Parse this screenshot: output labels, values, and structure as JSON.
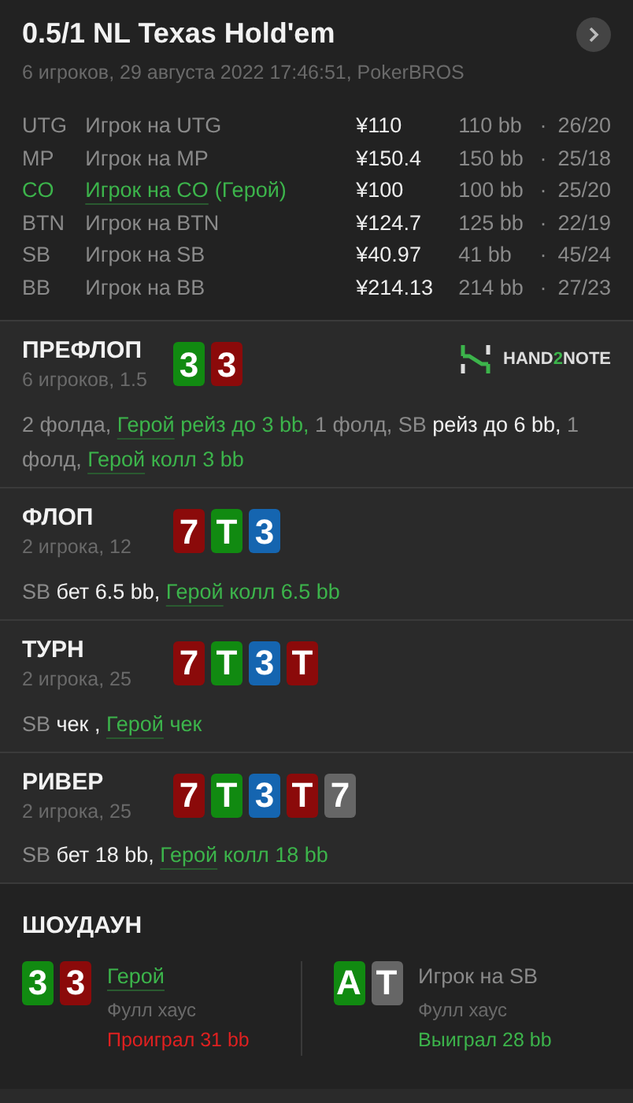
{
  "header": {
    "title": "0.5/1 NL Texas Hold'em",
    "subtitle": "6 игроков, 29 августа 2022 17:46:51, PokerBROS"
  },
  "players": [
    {
      "position": "UTG",
      "name": "Игрок на UTG",
      "hero": false,
      "stack": "¥110",
      "bb": "110 bb",
      "separator": "·",
      "stats": "26/20"
    },
    {
      "position": "MP",
      "name": "Игрок на MP",
      "hero": false,
      "stack": "¥150.4",
      "bb": "150 bb",
      "separator": "·",
      "stats": "25/18"
    },
    {
      "position": "CO",
      "name": "Игрок на CO",
      "hero_tag": "(Герой)",
      "hero": true,
      "stack": "¥100",
      "bb": "100 bb",
      "separator": "·",
      "stats": "25/20"
    },
    {
      "position": "BTN",
      "name": "Игрок на BTN",
      "hero": false,
      "stack": "¥124.7",
      "bb": "125 bb",
      "separator": "·",
      "stats": "22/19"
    },
    {
      "position": "SB",
      "name": "Игрок на SB",
      "hero": false,
      "stack": "¥40.97",
      "bb": "41 bb",
      "separator": "·",
      "stats": "45/24"
    },
    {
      "position": "BB",
      "name": "Игрок на BB",
      "hero": false,
      "stack": "¥214.13",
      "bb": "214 bb",
      "separator": "·",
      "stats": "27/23"
    }
  ],
  "logo": {
    "parts": [
      "HAND",
      "2",
      "NOTE"
    ]
  },
  "streets": [
    {
      "title": "ПРЕФЛОП",
      "info": "6 игроков, 1.5",
      "logo": true,
      "cards": [
        {
          "rank": "3",
          "color": "#118a11"
        },
        {
          "rank": "3",
          "color": "#8b0a0a"
        }
      ],
      "actions": [
        {
          "text": "2 фолда, ",
          "kind": "muted"
        },
        {
          "text": "Герой",
          "kind": "hero"
        },
        {
          "text": " рейз до 3 bb,",
          "kind": "hero_action"
        },
        {
          "text": " 1 фолд, SB ",
          "kind": "muted"
        },
        {
          "text": "рейз до 6 bb,",
          "kind": "action"
        },
        {
          "text": " 1 фолд, ",
          "kind": "muted"
        },
        {
          "text": "Герой",
          "kind": "hero"
        },
        {
          "text": " колл 3 bb",
          "kind": "hero_action"
        }
      ]
    },
    {
      "title": "ФЛОП",
      "info": "2 игрока, 12",
      "logo": false,
      "cards": [
        {
          "rank": "7",
          "color": "#8b0a0a"
        },
        {
          "rank": "T",
          "color": "#118a11"
        },
        {
          "rank": "3",
          "color": "#1565b0"
        }
      ],
      "actions": [
        {
          "text": "SB ",
          "kind": "muted"
        },
        {
          "text": "бет 6.5 bb, ",
          "kind": "action"
        },
        {
          "text": "Герой",
          "kind": "hero"
        },
        {
          "text": " колл 6.5 bb",
          "kind": "hero_action"
        }
      ]
    },
    {
      "title": "ТУРН",
      "info": "2 игрока, 25",
      "logo": false,
      "cards": [
        {
          "rank": "7",
          "color": "#8b0a0a"
        },
        {
          "rank": "T",
          "color": "#118a11"
        },
        {
          "rank": "3",
          "color": "#1565b0"
        },
        {
          "rank": "T",
          "color": "#8b0a0a"
        }
      ],
      "actions": [
        {
          "text": "SB ",
          "kind": "muted"
        },
        {
          "text": "чек , ",
          "kind": "action"
        },
        {
          "text": "Герой",
          "kind": "hero"
        },
        {
          "text": " чек",
          "kind": "hero_action"
        }
      ]
    },
    {
      "title": "РИВЕР",
      "info": "2 игрока, 25",
      "logo": false,
      "cards": [
        {
          "rank": "7",
          "color": "#8b0a0a"
        },
        {
          "rank": "T",
          "color": "#118a11"
        },
        {
          "rank": "3",
          "color": "#1565b0"
        },
        {
          "rank": "T",
          "color": "#8b0a0a"
        },
        {
          "rank": "7",
          "color": "#666666"
        }
      ],
      "actions": [
        {
          "text": "SB ",
          "kind": "muted"
        },
        {
          "text": "бет 18 bb, ",
          "kind": "action"
        },
        {
          "text": "Герой",
          "kind": "hero"
        },
        {
          "text": " колл 18 bb",
          "kind": "hero_action"
        }
      ]
    }
  ],
  "showdown": {
    "title": "ШОУДАУН",
    "hands": [
      {
        "name": "Герой",
        "hero": true,
        "hand": "Фулл хаус",
        "result": "Проиграл 31 bb",
        "won": false,
        "cards": [
          {
            "rank": "3",
            "color": "#118a11"
          },
          {
            "rank": "3",
            "color": "#8b0a0a"
          }
        ]
      },
      {
        "name": "Игрок на SB",
        "hero": false,
        "hand": "Фулл хаус",
        "result": "Выиграл 28 bb",
        "won": true,
        "cards": [
          {
            "rank": "A",
            "color": "#118a11"
          },
          {
            "rank": "T",
            "color": "#666666"
          }
        ]
      }
    ]
  }
}
